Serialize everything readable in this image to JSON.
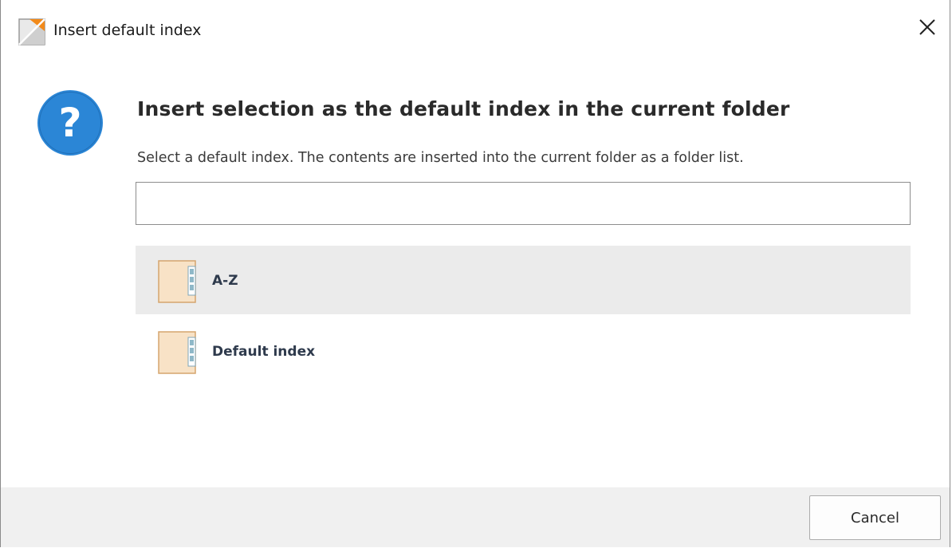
{
  "window": {
    "title": "Insert default index",
    "app_icon": "app-logo-icon",
    "close_icon": "close-icon"
  },
  "dialog": {
    "icon": "question-icon",
    "heading": "Insert selection as the default index in the current folder",
    "description": "Select a default index. The contents are inserted into the current folder as a folder list.",
    "search": {
      "value": "",
      "placeholder": ""
    },
    "items": [
      {
        "label": "A-Z",
        "icon": "index-folder-icon",
        "selected": true
      },
      {
        "label": "Default index",
        "icon": "index-folder-icon",
        "selected": false
      }
    ]
  },
  "footer": {
    "cancel_label": "Cancel"
  },
  "colors": {
    "question_blue": "#2b86d6",
    "folder_fill": "#f8e2c6",
    "folder_stroke": "#d5a56e",
    "index_tab": "#8fb8c8",
    "selected_row": "#ebebeb",
    "footer_bg": "#f0f0f0"
  }
}
